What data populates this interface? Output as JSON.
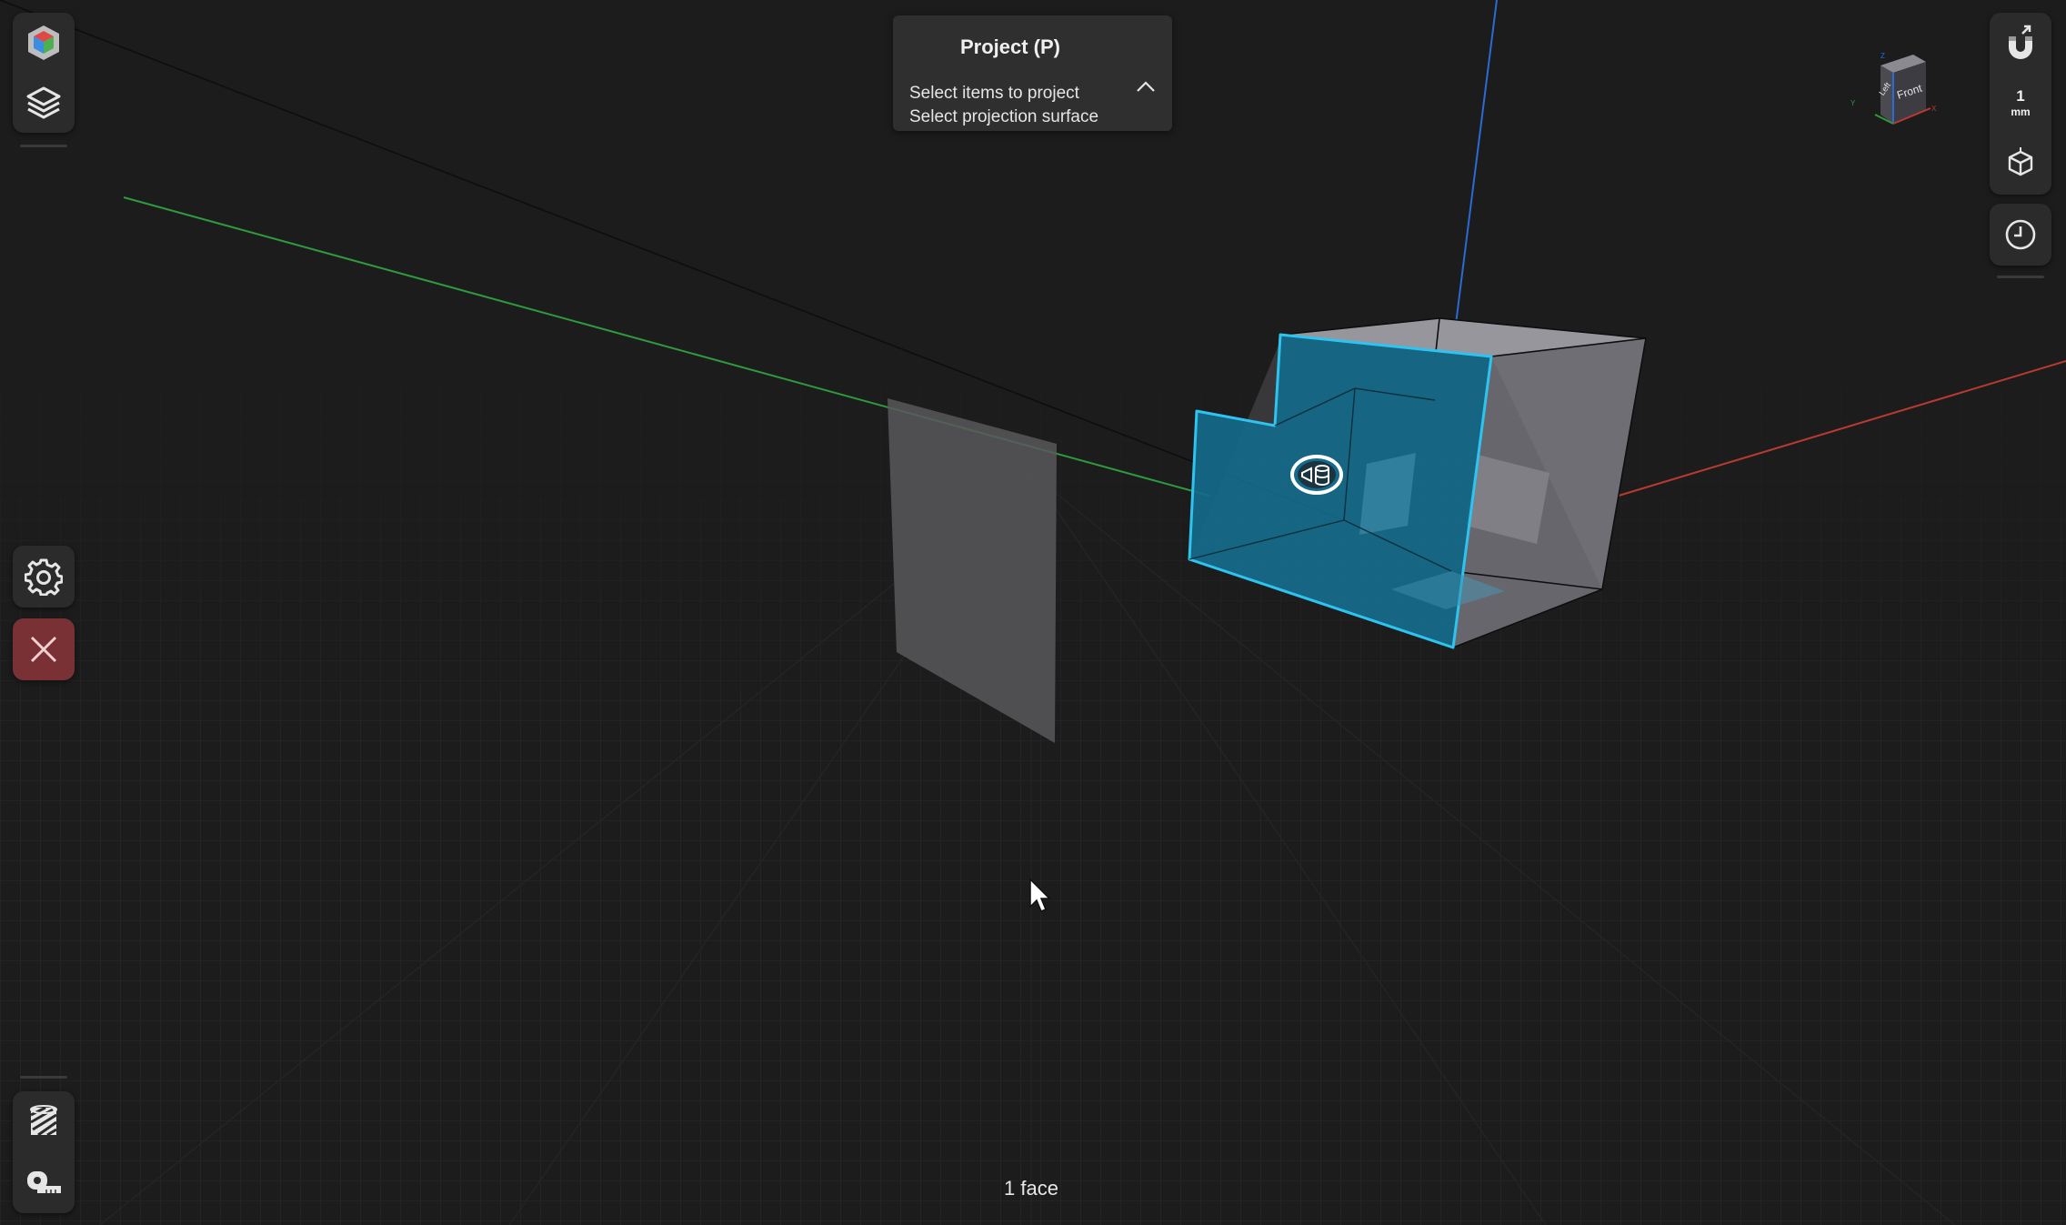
{
  "popup": {
    "title": "Project (P)",
    "steps": [
      "Select items to project",
      "Select projection surface"
    ]
  },
  "status": {
    "selection": "1 face"
  },
  "units": {
    "value": "1",
    "unit": "mm"
  },
  "view_cube": {
    "left_label": "Left",
    "front_label": "Front",
    "axes": {
      "x": "X",
      "y": "Y",
      "z": "Z"
    }
  },
  "icons": {
    "appearance": "appearance-cube-icon",
    "layers": "layers-icon",
    "settings": "gear-icon",
    "close": "close-icon",
    "snap": "magnet-icon",
    "view": "view-cube-icon",
    "history": "clock-icon",
    "section": "section-plane-icon",
    "measure": "tape-measure-icon",
    "expand": "chevron-up-icon"
  },
  "colors": {
    "background": "#1c1c1c",
    "grid": "#2a2a2a",
    "axis_x": "#b83a32",
    "axis_y": "#2f9a3e",
    "axis_z": "#2a6bd6",
    "selection_fill": "#136a8a",
    "selection_edge": "#2fc4f0",
    "body_gray": "#6e6e74",
    "close_button": "#7a3135"
  }
}
